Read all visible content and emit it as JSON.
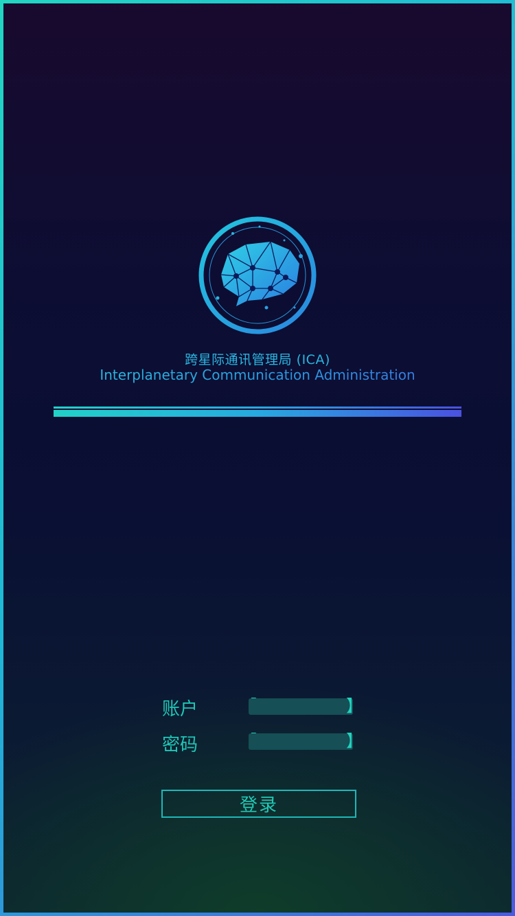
{
  "header": {
    "title_cn": "跨星际通讯管理局 (ICA)",
    "title_en": "Interplanetary Communication Administration"
  },
  "logo": {
    "icon": "brain-network-chat-icon"
  },
  "form": {
    "account_label": "账户",
    "account_value": "",
    "password_label": "密码",
    "password_value": "",
    "submit_label": "登录"
  },
  "colors": {
    "teal": "#22d1bd",
    "cyan": "#2ab6e0",
    "violet": "#4a52e0",
    "field": "#164f56"
  }
}
